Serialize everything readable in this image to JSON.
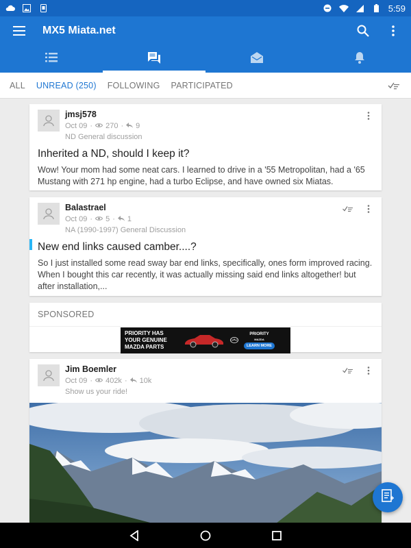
{
  "status_bar": {
    "time": "5:59",
    "left_icons": [
      "cloud-icon",
      "image-icon",
      "phone-icon"
    ],
    "right_icons": [
      "dnd-icon",
      "wifi-icon",
      "signal-icon",
      "battery-icon"
    ]
  },
  "app": {
    "title": "MX5 Miata.net",
    "accent_color": "#1e76d2",
    "actions": [
      "search-icon",
      "more-vert-icon"
    ],
    "tabs": [
      {
        "icon": "list-icon",
        "active": false
      },
      {
        "icon": "forum-icon",
        "active": true
      },
      {
        "icon": "inbox-icon",
        "active": false
      },
      {
        "icon": "bell-icon",
        "active": false
      }
    ]
  },
  "filters": {
    "items": [
      "ALL",
      "UNREAD (250)",
      "FOLLOWING",
      "PARTICIPATED"
    ],
    "active_index": 1
  },
  "posts": [
    {
      "author": "jmsj578",
      "date": "Oct 09",
      "views": "270",
      "replies": "9",
      "forum": "ND General discussion",
      "title": "Inherited a ND, should I keep it?",
      "body": "Wow! Your mom had some neat cars. I learned to drive in a '55 Metropolitan, had a '65 Mustang with 271 hp engine, had a turbo Eclipse, and have owned six Miatas.",
      "unread_marker": false,
      "mark_read_icon": false
    },
    {
      "author": "Balastrael",
      "date": "Oct 09",
      "views": "5",
      "replies": "1",
      "forum": "NA (1990-1997) General Discussion",
      "title": "New end links caused camber....?",
      "body": "So I just installed some read sway bar end links, specifically, ones form improved racing. When I bought this car recently, it was actually missing said end links altogether! but after installation,...",
      "unread_marker": true,
      "mark_read_icon": true
    }
  ],
  "sponsored": {
    "label": "SPONSORED",
    "ad": {
      "headline_1": "PRIORITY HAS",
      "headline_2": "YOUR GENUINE",
      "headline_3": "MAZDA PARTS",
      "brand": "PRIORITY",
      "brand_sub": "MAZDA",
      "cta": "LEARN MORE"
    }
  },
  "photo_post": {
    "author": "Jim Boemler",
    "date": "Oct 09",
    "views": "402k",
    "replies": "10k",
    "forum": "Show us your ride!"
  }
}
